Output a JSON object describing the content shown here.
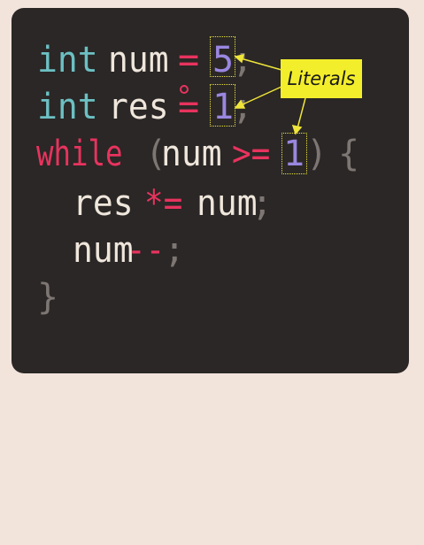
{
  "colors": {
    "background": "#f2e3db",
    "panel": "#2a2726",
    "keyword_type": "#6cc0c3",
    "keyword_control": "#e8335e",
    "identifier": "#efe6dc",
    "operator": "#e8335e",
    "number": "#9a87e0",
    "punctuation": "#7d7673",
    "annotation_fill": "#f3ee2b",
    "annotation_border": "#efe53a"
  },
  "code": {
    "line1": {
      "type": "int",
      "name": "num",
      "op": "=",
      "literal": "5",
      "end": ";"
    },
    "line2": {
      "type": "int",
      "name": "res",
      "op": "=",
      "literal": "1",
      "end": ";"
    },
    "line3": {
      "keyword": "while",
      "paren_open": "(",
      "name": "num",
      "op": ">=",
      "literal": "1",
      "paren_close": ")",
      "brace": "{"
    },
    "line4": {
      "name": "res",
      "op": "*=",
      "rhs": "num",
      "end": ";"
    },
    "line5": {
      "name": "num",
      "op": "--",
      "end": ";"
    },
    "line6": {
      "brace": "}"
    }
  },
  "annotation": {
    "label": "Literals"
  }
}
